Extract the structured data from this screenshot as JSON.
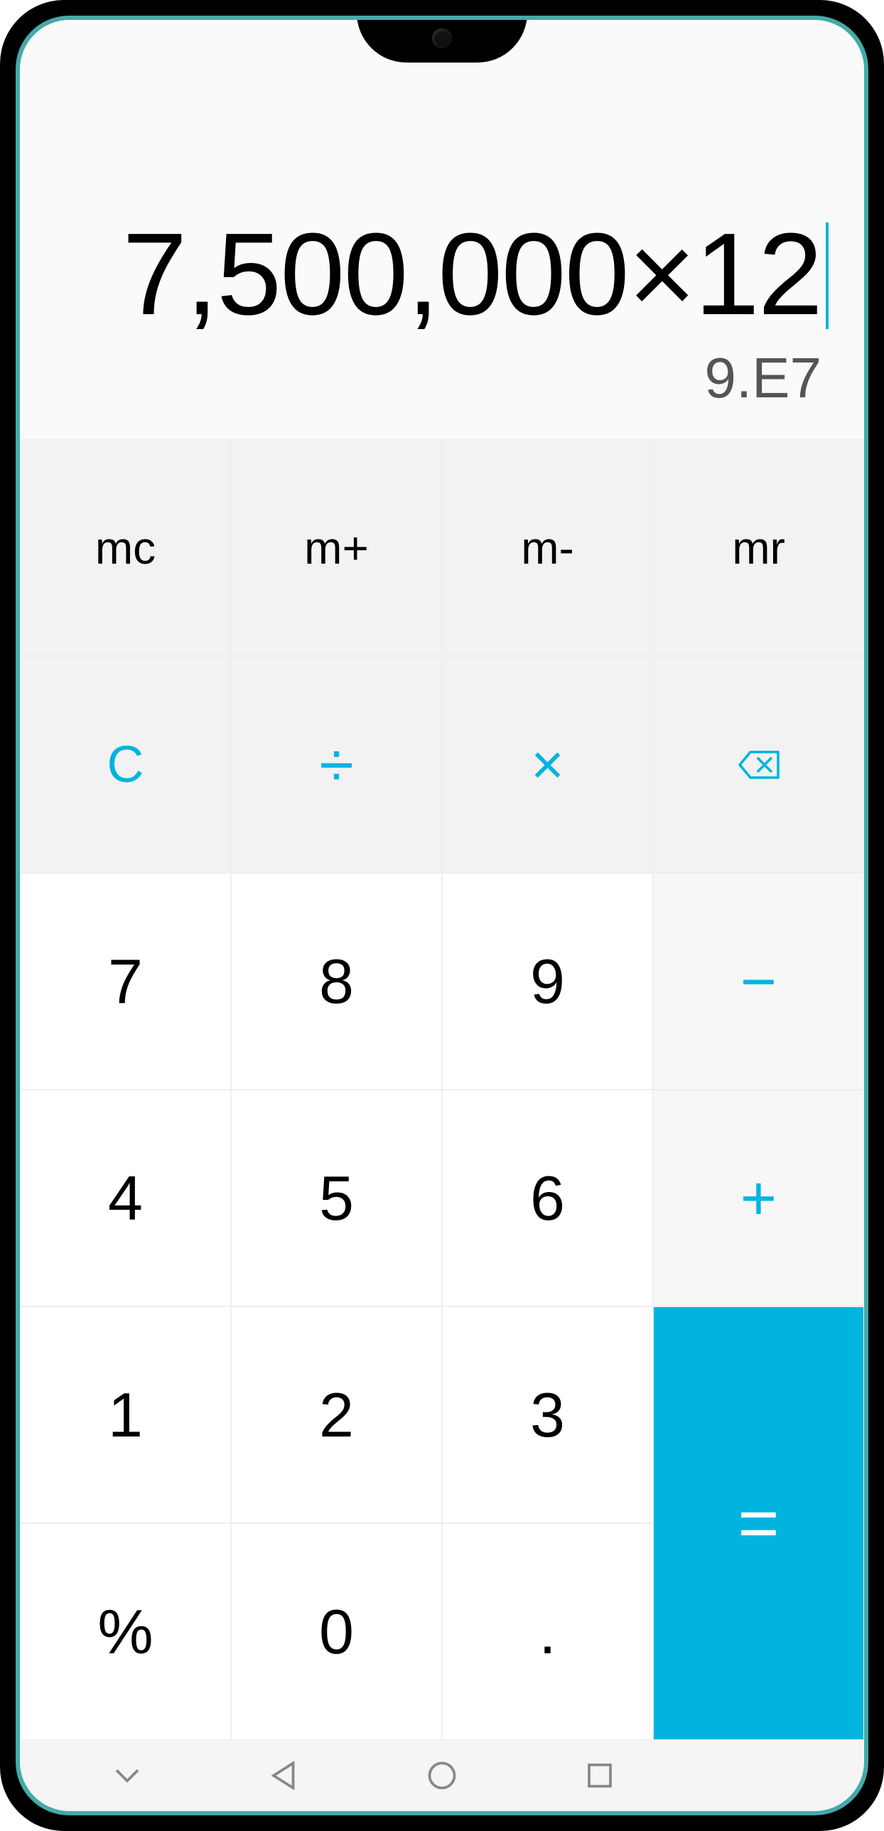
{
  "display": {
    "expression": "7,500,000×12",
    "result": "9.E7"
  },
  "buttons": {
    "mc": "mc",
    "mplus": "m+",
    "mminus": "m-",
    "mr": "mr",
    "clear": "C",
    "divide": "÷",
    "multiply": "×",
    "backspace": "⌫",
    "seven": "7",
    "eight": "8",
    "nine": "9",
    "minus": "−",
    "four": "4",
    "five": "5",
    "six": "6",
    "plus": "+",
    "one": "1",
    "two": "2",
    "three": "3",
    "equals": "=",
    "percent": "%",
    "zero": "0",
    "decimal": "."
  },
  "colors": {
    "accent": "#00b4e0",
    "equals_bg": "#00b4e0"
  }
}
